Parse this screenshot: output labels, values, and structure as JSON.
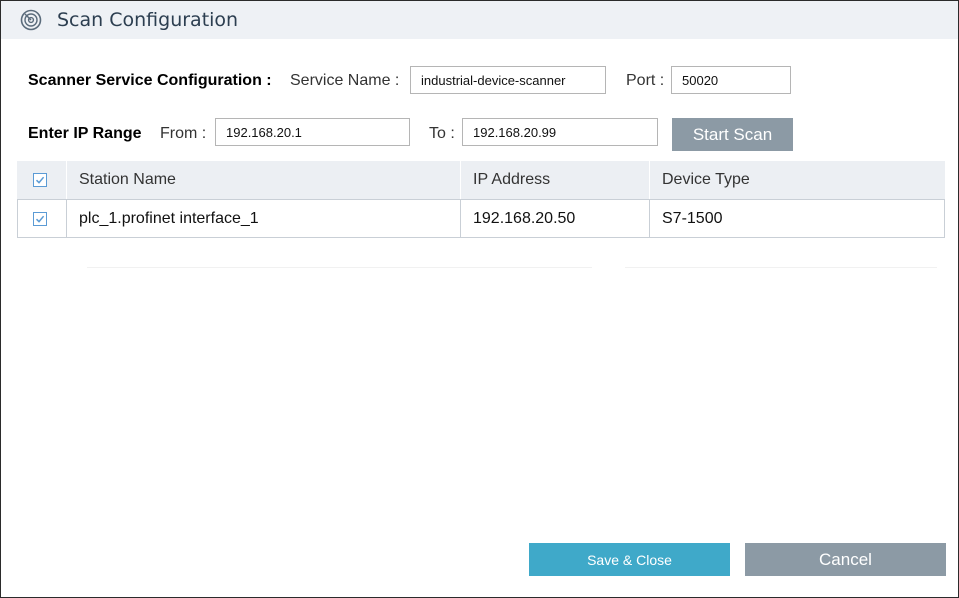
{
  "window": {
    "title": "Scan Configuration",
    "icon": "radar-scan-icon"
  },
  "scanner_config": {
    "heading": "Scanner Service Configuration :",
    "service_name_label": "Service Name :",
    "service_name_value": "industrial-device-scanner",
    "port_label": "Port :",
    "port_value": "50020"
  },
  "ip_range": {
    "heading": "Enter IP Range",
    "from_label": "From :",
    "from_value": "192.168.20.1",
    "to_label": "To :",
    "to_value": "192.168.20.99",
    "start_scan_label": "Start Scan"
  },
  "table": {
    "select_all_checked": true,
    "columns": [
      "Station Name",
      "IP Address",
      "Device Type"
    ],
    "rows": [
      {
        "checked": true,
        "station_name": "plc_1.profinet interface_1",
        "ip_address": "192.168.20.50",
        "device_type": "S7-1500"
      }
    ]
  },
  "footer": {
    "save_label": "Save & Close",
    "cancel_label": "Cancel"
  },
  "colors": {
    "primary_button": "#3fa9c9",
    "secondary_button": "#8c9aa5",
    "checkbox_accent": "#5b9bd5",
    "header_bg": "#eef1f5"
  }
}
